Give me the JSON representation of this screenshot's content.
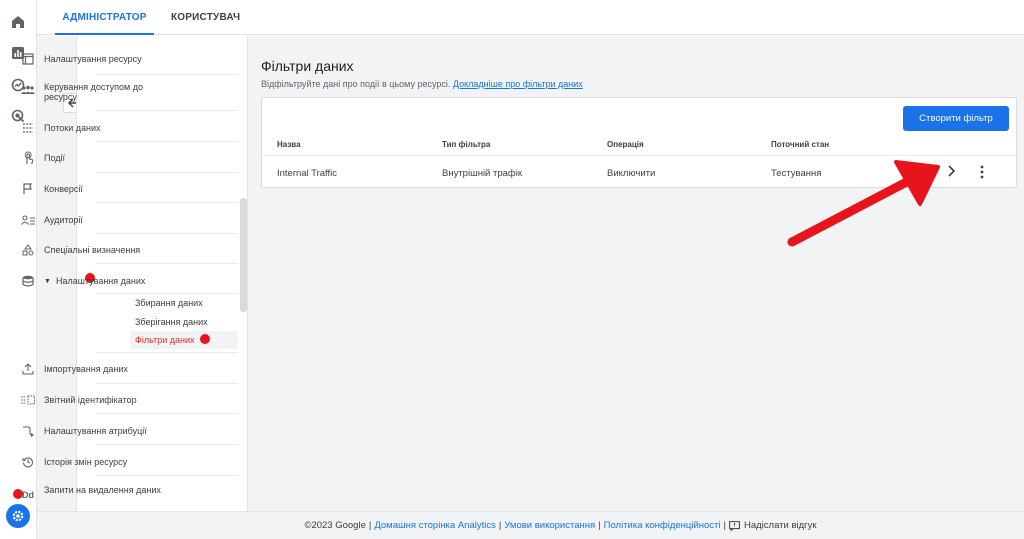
{
  "tabs": {
    "admin": "Адміністратор",
    "user": "Користувач"
  },
  "nav": {
    "items": [
      {
        "label": "Налаштування ресурсу",
        "icon": "window-icon"
      },
      {
        "label": "Керування доступом до ресурсу",
        "icon": "people-icon"
      },
      {
        "label": "Потоки даних",
        "icon": "streams-icon"
      },
      {
        "label": "Події",
        "icon": "touch-icon"
      },
      {
        "label": "Конверсії",
        "icon": "flag-icon"
      },
      {
        "label": "Аудиторії",
        "icon": "audience-icon"
      },
      {
        "label": "Спеціальні визначення",
        "icon": "shapes-icon"
      },
      {
        "label": "Налаштування даних",
        "icon": "database-icon",
        "expanded": true
      },
      {
        "label": "Імпортування даних",
        "icon": "upload-icon"
      },
      {
        "label": "Звітний ідентифікатор",
        "icon": "identifier-icon"
      },
      {
        "label": "Налаштування атрибуції",
        "icon": "attribution-icon"
      },
      {
        "label": "Історія змін ресурсу",
        "icon": "history-icon"
      },
      {
        "label": "Запити на видалення даних",
        "icon": "dd-icon"
      }
    ],
    "sub_items": [
      "Збирання даних",
      "Зберігання даних",
      "Фільтри даних"
    ],
    "active_sub": "Фільтри даних"
  },
  "content": {
    "title": "Фільтри даних",
    "description": "Відфільтруйте дані про події в цьому ресурсі.",
    "learn_more": "Докладніше про фільтри даних",
    "create_button": "Створити фільтр",
    "table": {
      "headers": [
        "Назва",
        "Тип фільтра",
        "Операція",
        "Поточний стан"
      ],
      "rows": [
        [
          "Internal Traffic",
          "Внутрішній трафік",
          "Виключити",
          "Тестування"
        ]
      ]
    }
  },
  "footer": {
    "copyright": "©2023 Google",
    "links": [
      "Домашня сторінка Analytics",
      "Умови використання",
      "Політика конфіденційності"
    ],
    "feedback": "Надіслати відгук"
  },
  "colors": {
    "accent": "#1a73e8",
    "annotation": "#e8141c",
    "active_sub": "#d93025"
  }
}
